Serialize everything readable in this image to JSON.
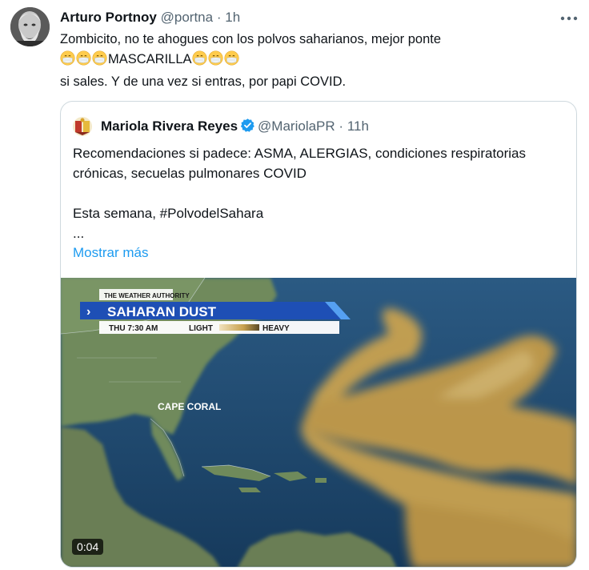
{
  "tweet": {
    "author_name": "Arturo Portnoy",
    "handle": "@portna",
    "separator": "·",
    "time": "1h",
    "line1": "Zombicito, no te ahogues con los polvos saharianos, mejor ponte",
    "line2_word": "MASCARILLA",
    "line3": "si sales. Y de una vez si entras, por papi COVID.",
    "emoji_name": "face-with-medical-mask-emoji",
    "more_icon": "more-horizontal-icon"
  },
  "quote": {
    "author_name": "Mariola Rivera Reyes",
    "handle": "@MariolaPR",
    "separator": "·",
    "time": "11h",
    "verified_icon": "verified-badge-icon",
    "line1": "Recomendaciones si padece: ASMA, ALERGIAS, condiciones respiratorias",
    "line2": "crónicas, secuelas pulmonares COVID",
    "line3": "Esta semana, #PolvodelSahara",
    "ellipsis": "...",
    "show_more": "Mostrar más"
  },
  "video": {
    "brand": "THE WEATHER AUTHORITY",
    "chevron": "›",
    "title": "SAHARAN DUST",
    "time_label": "THU 7:30 AM",
    "light_label": "LIGHT",
    "heavy_label": "HEAVY",
    "place_label": "CAPE CORAL",
    "duration": "0:04",
    "ocean_color": "#1f4e76",
    "dust_color": "#c9a24f",
    "banner_color": "#1e4fb5"
  }
}
